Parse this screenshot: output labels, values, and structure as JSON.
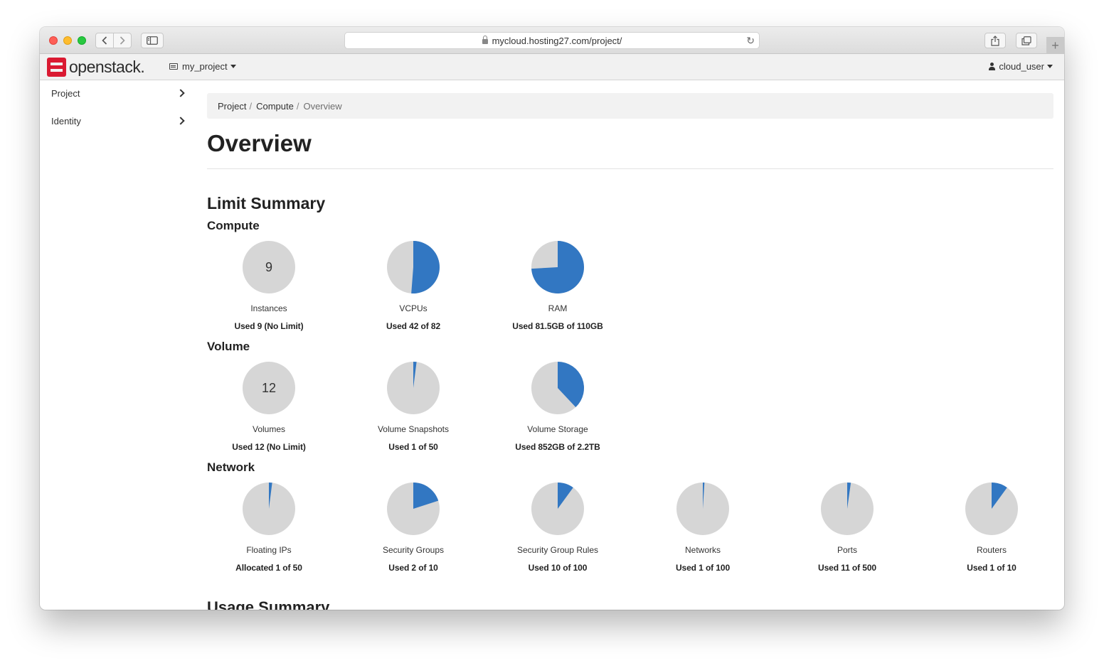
{
  "browser": {
    "url": "mycloud.hosting27.com/project/"
  },
  "header": {
    "logo_text": "openstack.",
    "project_name": "my_project",
    "user_name": "cloud_user"
  },
  "sidebar": {
    "items": [
      {
        "label": "Project"
      },
      {
        "label": "Identity"
      }
    ]
  },
  "breadcrumb": [
    "Project",
    "Compute",
    "Overview"
  ],
  "page_title": "Overview",
  "limit_summary": {
    "title": "Limit Summary",
    "groups": [
      {
        "title": "Compute",
        "charts": [
          {
            "label": "Instances",
            "usage": "Used 9 (No Limit)",
            "number": "9",
            "fraction": null
          },
          {
            "label": "VCPUs",
            "usage": "Used 42 of 82",
            "fraction": 0.5122
          },
          {
            "label": "RAM",
            "usage": "Used 81.5GB of 110GB",
            "fraction": 0.7409
          }
        ]
      },
      {
        "title": "Volume",
        "charts": [
          {
            "label": "Volumes",
            "usage": "Used 12 (No Limit)",
            "number": "12",
            "fraction": null
          },
          {
            "label": "Volume Snapshots",
            "usage": "Used 1 of 50",
            "fraction": 0.02
          },
          {
            "label": "Volume Storage",
            "usage": "Used 852GB of 2.2TB",
            "fraction": 0.38
          }
        ]
      },
      {
        "title": "Network",
        "charts": [
          {
            "label": "Floating IPs",
            "usage": "Allocated 1 of 50",
            "fraction": 0.02
          },
          {
            "label": "Security Groups",
            "usage": "Used 2 of 10",
            "fraction": 0.2
          },
          {
            "label": "Security Group Rules",
            "usage": "Used 10 of 100",
            "fraction": 0.1
          },
          {
            "label": "Networks",
            "usage": "Used 1 of 100",
            "fraction": 0.01
          },
          {
            "label": "Ports",
            "usage": "Used 11 of 500",
            "fraction": 0.022
          },
          {
            "label": "Routers",
            "usage": "Used 1 of 10",
            "fraction": 0.1
          }
        ]
      }
    ]
  },
  "usage_summary": {
    "title": "Usage Summary"
  },
  "colors": {
    "used": "#3277c2",
    "free": "#d6d6d6",
    "brand": "#da1a32"
  }
}
